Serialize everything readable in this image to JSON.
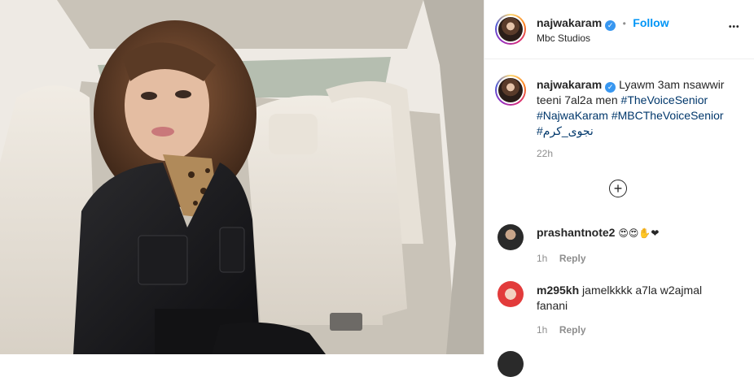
{
  "post": {
    "username": "najwakaram",
    "location": "Mbc Studios",
    "follow_label": "Follow",
    "separator": "•",
    "more_label": "•••",
    "caption_user": "najwakaram",
    "caption_line1": "Lyawm 3am nsawwir",
    "caption_line2_text": "teeni 7al2a men",
    "tag1": "#TheVoiceSenior",
    "tag2": "#NajwaKaram",
    "tag3": "#MBCTheVoiceSenior",
    "tag4": "#نجوى_كرم",
    "time": "22h",
    "load_more_label": "+"
  },
  "comments": [
    {
      "user": "prashantnote2",
      "text": "😍😍✋❤",
      "time": "1h",
      "reply": "Reply"
    },
    {
      "user": "m295kh",
      "text_line1": "jamelkkkk a7la w2ajmal",
      "text_line2": "fanani",
      "time": "1h",
      "reply": "Reply"
    }
  ],
  "colors": {
    "accent": "#0095f6",
    "verified": "#3897f0",
    "text": "#262626",
    "muted": "#8e8e8e"
  }
}
